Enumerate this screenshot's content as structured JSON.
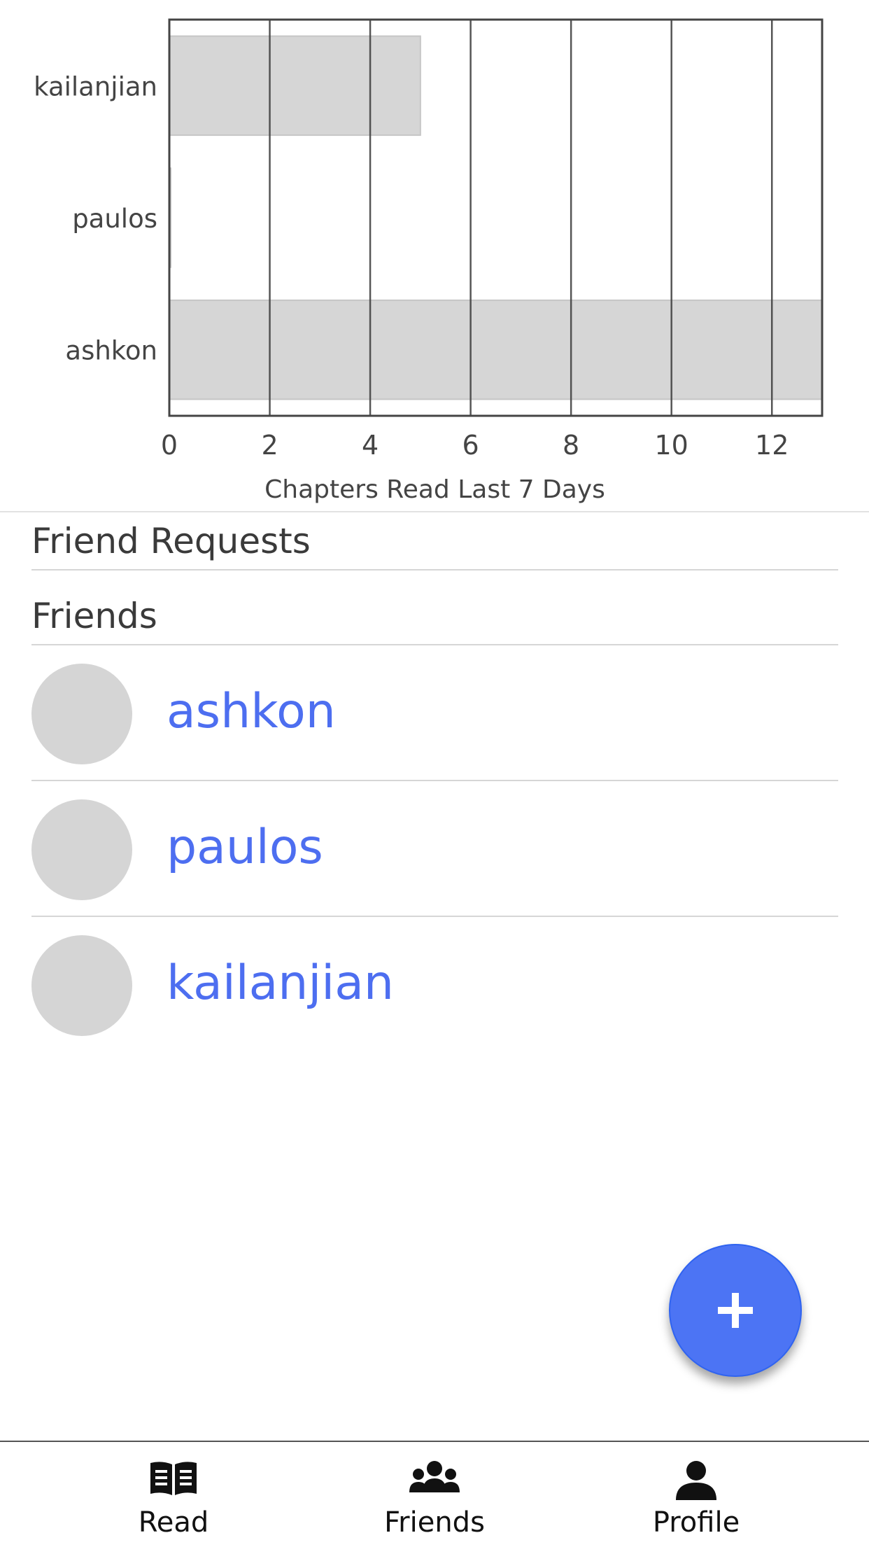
{
  "chart_data": {
    "type": "bar",
    "orientation": "horizontal",
    "categories": [
      "kailanjian",
      "paulos",
      "ashkon"
    ],
    "values": [
      5,
      0,
      13
    ],
    "xlabel": "Chapters Read Last 7 Days",
    "xlim": [
      0,
      13
    ],
    "xticks": [
      0,
      2,
      4,
      6,
      8,
      10,
      12
    ],
    "grid": "vertical",
    "colors": {
      "bar": "#d6d6d6",
      "bar_edge": "#c6c6c6",
      "grid": "#444444",
      "text": "#444444"
    }
  },
  "sections": {
    "friend_requests": "Friend Requests",
    "friends": "Friends"
  },
  "friends": [
    {
      "name": "ashkon"
    },
    {
      "name": "paulos"
    },
    {
      "name": "kailanjian"
    }
  ],
  "fab": {
    "label": "+",
    "icon": "plus-icon"
  },
  "nav": {
    "items": [
      {
        "label": "Read",
        "icon": "book-open-icon"
      },
      {
        "label": "Friends",
        "icon": "users-icon"
      },
      {
        "label": "Profile",
        "icon": "user-icon"
      }
    ]
  },
  "colors": {
    "accent": "#4c74f4",
    "link": "#4d6ef0"
  }
}
